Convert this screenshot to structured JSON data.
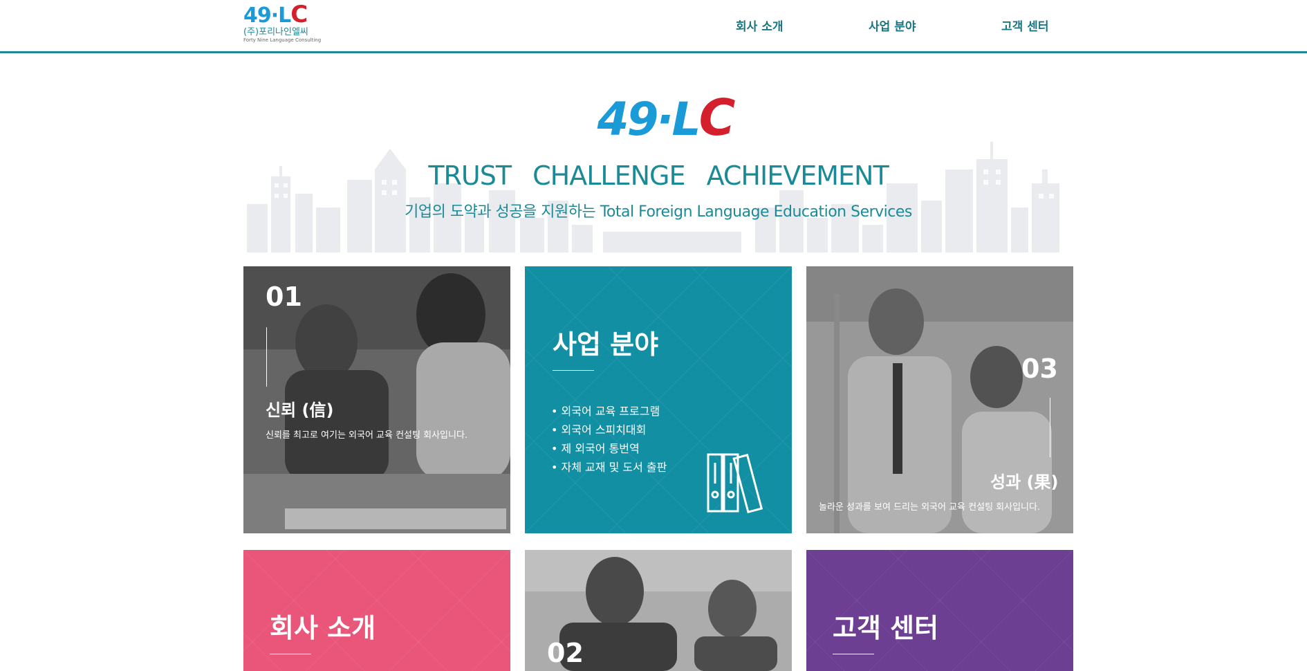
{
  "header": {
    "logo_mark_num": "49·L",
    "logo_mark_c": "C",
    "logo_kor": "(주)포리나인엘씨",
    "logo_eng": "Forty Nine Language Consulting",
    "nav": [
      {
        "label": "회사 소개"
      },
      {
        "label": "사업 분야"
      },
      {
        "label": "고객 센터"
      }
    ]
  },
  "hero": {
    "logo_num": "49·L",
    "logo_c": "C",
    "tagline": "TRUST CHALLENGE ACHIEVEMENT",
    "subtitle": "기업의 도약과 성공을 지원하는 Total Foreign Language Education Services"
  },
  "tiles": {
    "trust": {
      "number": "01",
      "title": "신뢰 (信)",
      "desc": "신뢰를 최고로 여기는 외국어 교육 컨설팅 회사입니다."
    },
    "business": {
      "title": "사업 분야",
      "items": [
        "• 외국어 교육 프로그램",
        "• 외국어 스피치대회",
        "• 제 외국어 통번역",
        "• 자체 교재 및 도서 출판"
      ]
    },
    "achievement": {
      "number": "03",
      "title": "성과 (果)",
      "desc": "놀라운 성과를 보여 드리는 외국어 교육 컨설팅 회사입니다."
    },
    "about": {
      "title": "회사 소개"
    },
    "challenge": {
      "number": "02"
    },
    "support": {
      "title": "고객 센터"
    }
  },
  "colors": {
    "teal": "#128fa3",
    "pink": "#e9567a",
    "purple": "#6d3f93",
    "header_line": "#1a8a97"
  }
}
